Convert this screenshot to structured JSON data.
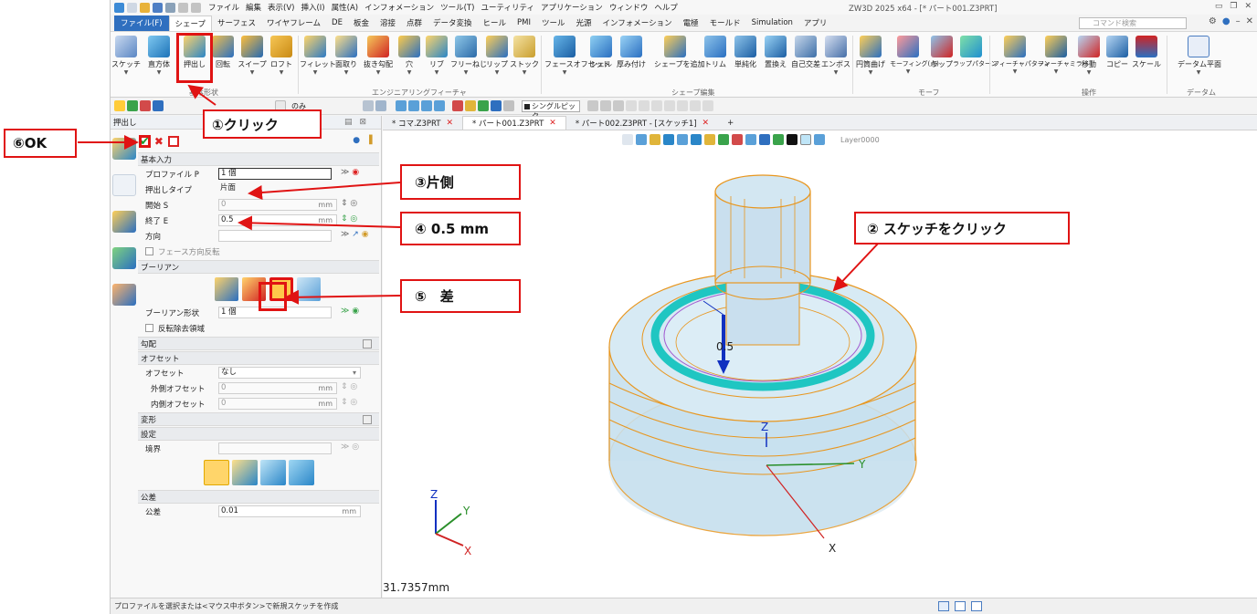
{
  "window": {
    "title": "ZW3D 2025 x64 - [* パート001.Z3PRT]"
  },
  "menu": [
    "ファイル",
    "編集",
    "表示(V)",
    "挿入(I)",
    "属性(A)",
    "インフォメーション",
    "ツール(T)",
    "ユーティリティ",
    "アプリケーション",
    "ウィンドウ",
    "ヘルプ"
  ],
  "ribbon_tabs": [
    "ファイル(F)",
    "シェープ",
    "サーフェス",
    "ワイヤフレーム",
    "DE",
    "板金",
    "溶接",
    "点群",
    "データ変換",
    "ヒール",
    "PMI",
    "ツール",
    "光源",
    "インフォメーション",
    "電極",
    "モールド",
    "Simulation",
    "アプリ"
  ],
  "command_search": {
    "placeholder": "コマンド検索"
  },
  "ribbon": {
    "buttons": [
      "スケッチ",
      "直方体",
      "押出し",
      "回転",
      "スイープ",
      "ロフト",
      "フィレット",
      "面取り",
      "抜き勾配",
      "穴",
      "リブ",
      "フリーねじ",
      "リップ",
      "ストック",
      "フェースオフセット",
      "シェル",
      "厚み付け",
      "シェープを追加",
      "トリム",
      "単純化",
      "置換え",
      "自己交差",
      "エンボス",
      "円筒曲げ",
      "モーフィング(点)",
      "ラップ",
      "ラップパターン",
      "フィーチャパターン",
      "フィーチャミラー",
      "移動",
      "コピー",
      "スケール",
      "データム平面"
    ],
    "groups": [
      "基本形状",
      "エンジニアリングフィーチャ",
      "シェープ編集",
      "モーフ",
      "操作",
      "データム"
    ]
  },
  "toolstrip": {
    "filter_label": "のみ",
    "pick_mode": "シングルピック"
  },
  "panel": {
    "title": "押出し",
    "sections": {
      "basic": "基本入力",
      "boolean": "ブーリアン",
      "draft": "勾配",
      "offset": "オフセット",
      "transform": "変形",
      "settings": "設定",
      "tolerance": "公差"
    },
    "fields": {
      "profile_label": "プロファイル P",
      "profile_value": "1 個",
      "type_label": "押出しタイプ",
      "type_value": "片面",
      "start_label": "開始 S",
      "start_value": "0",
      "start_unit": "mm",
      "end_label": "終了 E",
      "end_value": "0.5",
      "end_unit": "mm",
      "direction_label": "方向",
      "flip_label": "フェース方向反転",
      "boolean_shape_label": "ブーリアン形状",
      "boolean_shape_value": "1 個",
      "reverse_label": "反転除去領域",
      "offset_label": "オフセット",
      "offset_value": "なし",
      "outer_label": "外側オフセット",
      "outer_value": "0",
      "outer_unit": "mm",
      "inner_label": "内側オフセット",
      "inner_value": "0",
      "inner_unit": "mm",
      "boundary_label": "境界",
      "tol_label": "公差",
      "tol_value": "0.01",
      "tol_unit": "mm"
    }
  },
  "doc_tabs": [
    "* コマ.Z3PRT",
    "* パート001.Z3PRT",
    "* パート002.Z3PRT - [スケッチ1]"
  ],
  "viewport": {
    "layer": "Layer0000",
    "measure": "31.7357mm",
    "dim_label": "0.5",
    "axis_z": "Z",
    "axis_y": "Y",
    "axis_x": "X"
  },
  "status": {
    "text": "プロファイルを選択または<マウス中ボタン>で新規スケッチを作成"
  },
  "annotations": {
    "c1": "①クリック",
    "c2": "② スケッチをクリック",
    "c3": "③片側",
    "c4": "④ 0.5 mm",
    "c5": "⑤　差",
    "c6": "⑥OK"
  },
  "colors": {
    "accent": "#2f6fbf",
    "annotation": "#e01313",
    "model": "#e8961e",
    "ring": "#1fc6c2"
  }
}
